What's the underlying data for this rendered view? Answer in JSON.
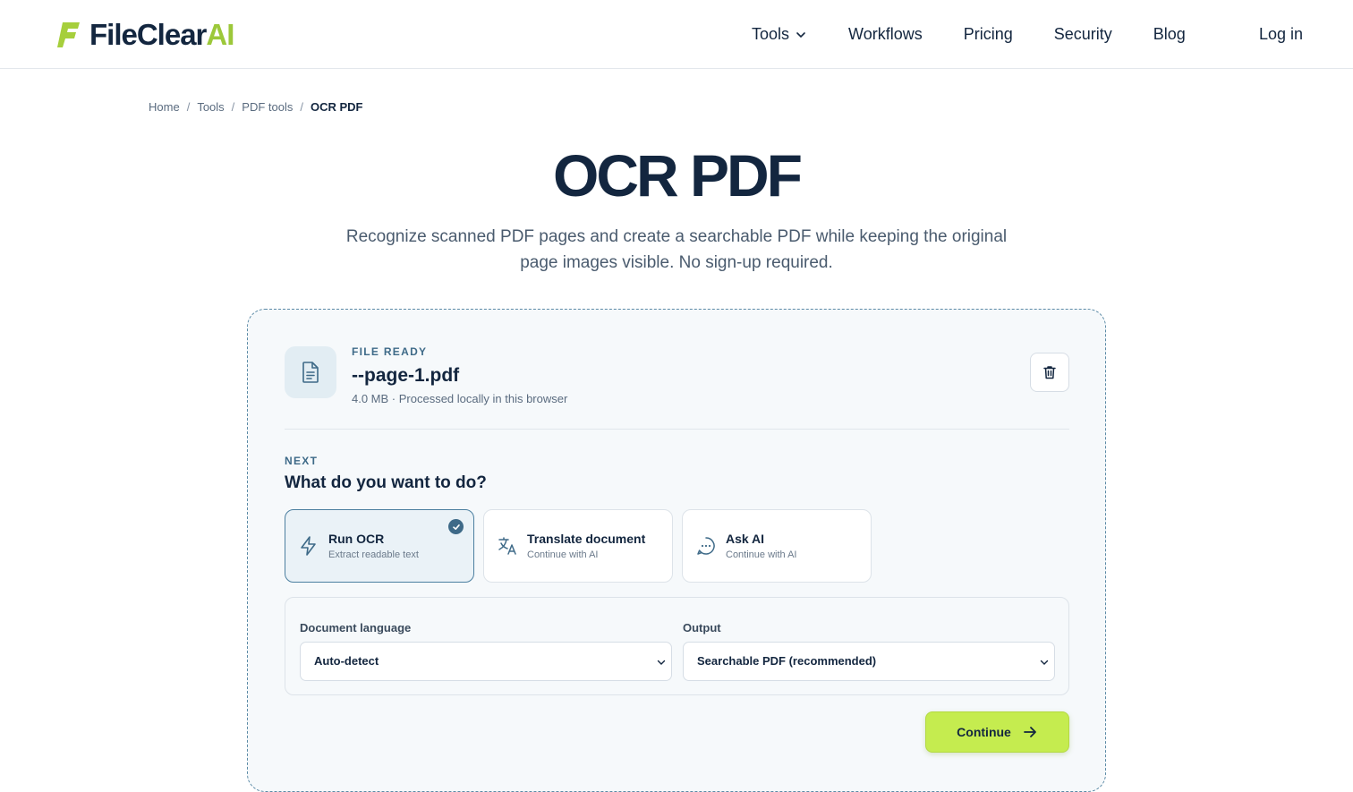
{
  "brand": {
    "name": "FileClear",
    "suffix": "AI",
    "primary_color": "#13263f",
    "accent_color": "#9cc83a",
    "button_color": "#c5ec4f"
  },
  "nav": {
    "items": [
      {
        "label": "Tools",
        "icon": "chevron-down-icon"
      },
      {
        "label": "Workflows"
      },
      {
        "label": "Pricing"
      },
      {
        "label": "Security"
      },
      {
        "label": "Blog"
      }
    ],
    "login": "Log in"
  },
  "breadcrumb": {
    "items": [
      "Home",
      "Tools",
      "PDF tools"
    ],
    "separator": "/",
    "current": "OCR PDF"
  },
  "page": {
    "title": "OCR PDF",
    "subtitle": "Recognize scanned PDF pages and create a searchable PDF while keeping the original page images visible. No sign-up required."
  },
  "file": {
    "status": "FILE READY",
    "name": "--page-1.pdf",
    "meta": "4.0 MB · Processed locally in this browser",
    "icon": "file-text-icon"
  },
  "next": {
    "label": "NEXT",
    "question": "What do you want to do?",
    "options": [
      {
        "title": "Run OCR",
        "subtitle": "Extract readable text",
        "icon": "lightning-icon",
        "selected": true
      },
      {
        "title": "Translate document",
        "subtitle": "Continue with AI",
        "icon": "translate-icon",
        "selected": false
      },
      {
        "title": "Ask AI",
        "subtitle": "Continue with AI",
        "icon": "chat-icon",
        "selected": false
      }
    ]
  },
  "settings": {
    "language_label": "Document language",
    "language_value": "Auto-detect",
    "output_label": "Output",
    "output_value": "Searchable PDF (recommended)"
  },
  "actions": {
    "continue_label": "Continue"
  }
}
